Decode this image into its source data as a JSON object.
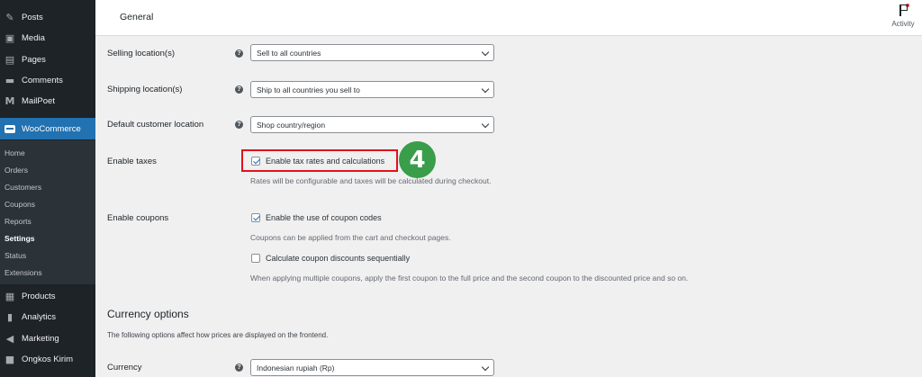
{
  "sidebar": {
    "top_items": [
      {
        "label": "Posts",
        "icon": "pin-icon"
      },
      {
        "label": "Media",
        "icon": "media-icon"
      },
      {
        "label": "Pages",
        "icon": "pages-icon"
      },
      {
        "label": "Comments",
        "icon": "comments-icon"
      },
      {
        "label": "MailPoet",
        "icon": "mailpoet-icon"
      }
    ],
    "woocommerce": {
      "label": "WooCommerce",
      "icon": "woo-icon"
    },
    "submenu": [
      "Home",
      "Orders",
      "Customers",
      "Coupons",
      "Reports",
      "Settings",
      "Status",
      "Extensions"
    ],
    "submenu_current": "Settings",
    "bottom_items": [
      {
        "label": "Products",
        "icon": "products-icon"
      },
      {
        "label": "Analytics",
        "icon": "analytics-icon"
      },
      {
        "label": "Marketing",
        "icon": "marketing-icon"
      },
      {
        "label": "Ongkos Kirim",
        "icon": "truck-icon"
      }
    ]
  },
  "header": {
    "title": "General",
    "activity_label": "Activity"
  },
  "form": {
    "selling": {
      "label": "Selling location(s)",
      "value": "Sell to all countries"
    },
    "shipping": {
      "label": "Shipping location(s)",
      "value": "Ship to all countries you sell to"
    },
    "default_location": {
      "label": "Default customer location",
      "value": "Shop country/region"
    },
    "taxes": {
      "label": "Enable taxes",
      "checkbox_label": "Enable tax rates and calculations",
      "checked": true,
      "description": "Rates will be configurable and taxes will be calculated during checkout."
    },
    "coupons": {
      "label": "Enable coupons",
      "enable_label": "Enable the use of coupon codes",
      "enable_checked": true,
      "enable_description": "Coupons can be applied from the cart and checkout pages.",
      "sequential_label": "Calculate coupon discounts sequentially",
      "sequential_checked": false,
      "sequential_description": "When applying multiple coupons, apply the first coupon to the full price and the second coupon to the discounted price and so on."
    },
    "currency_section": {
      "title": "Currency options",
      "description": "The following options affect how prices are displayed on the frontend."
    },
    "currency": {
      "label": "Currency",
      "value": "Indonesian rupiah (Rp)"
    }
  },
  "annotation": {
    "step_number": "4",
    "color": "#3a9d4a",
    "highlight_color": "#e0121b"
  },
  "colors": {
    "sidebar_bg": "#1d2327",
    "active_bg": "#2271b1",
    "submenu_bg": "#2c3338"
  }
}
